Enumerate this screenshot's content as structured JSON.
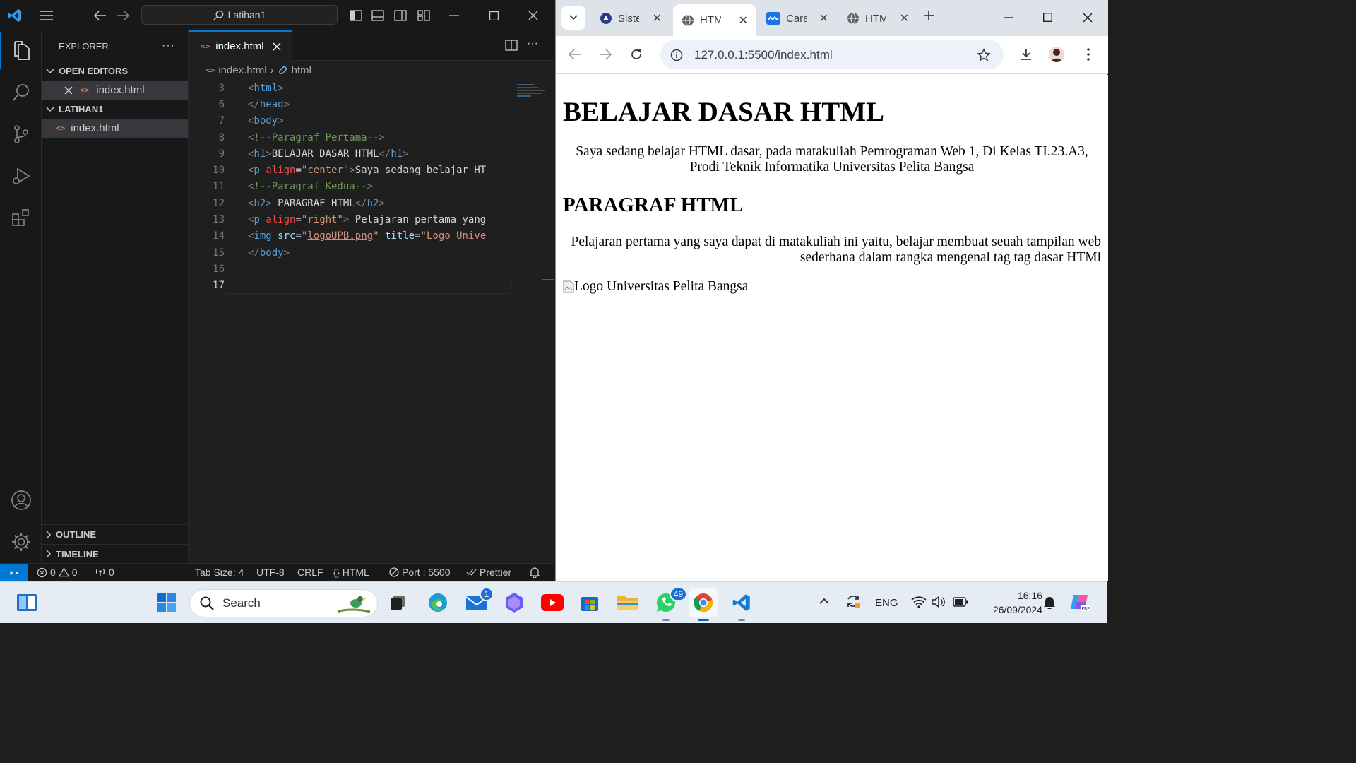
{
  "vscode": {
    "command_center": "Latihan1",
    "explorer": {
      "title": "EXPLORER",
      "open_editors_label": "OPEN EDITORS",
      "open_file": "index.html",
      "folder_label": "LATIHAN1",
      "folder_file": "index.html",
      "outline_label": "OUTLINE",
      "timeline_label": "TIMELINE"
    },
    "tab": {
      "label": "index.html"
    },
    "breadcrumb": {
      "file": "index.html",
      "symbol": "html"
    },
    "code_lines": [
      {
        "num": "3",
        "tokens": [
          {
            "c": "tg",
            "t": "<"
          },
          {
            "c": "tn",
            "t": "html"
          },
          {
            "c": "tg",
            "t": ">"
          }
        ]
      },
      {
        "num": "6",
        "tokens": [
          {
            "c": "tg",
            "t": "</"
          },
          {
            "c": "tn",
            "t": "head"
          },
          {
            "c": "tg",
            "t": ">"
          }
        ]
      },
      {
        "num": "7",
        "tokens": [
          {
            "c": "tg",
            "t": "<"
          },
          {
            "c": "tn",
            "t": "body"
          },
          {
            "c": "tg",
            "t": ">"
          }
        ]
      },
      {
        "num": "8",
        "tokens": [
          {
            "c": "cm",
            "t": "<!--Paragraf Pertama-->"
          }
        ]
      },
      {
        "num": "9",
        "tokens": [
          {
            "c": "tg",
            "t": "<"
          },
          {
            "c": "tn",
            "t": "h1"
          },
          {
            "c": "tg",
            "t": ">"
          },
          {
            "c": "tx",
            "t": "BELAJAR DASAR HTML"
          },
          {
            "c": "tg",
            "t": "</"
          },
          {
            "c": "tn",
            "t": "h1"
          },
          {
            "c": "tg",
            "t": ">"
          }
        ]
      },
      {
        "num": "10",
        "tokens": [
          {
            "c": "tg",
            "t": "<"
          },
          {
            "c": "tn",
            "t": "p"
          },
          {
            "c": "tx",
            "t": " "
          },
          {
            "c": "ar",
            "t": "align"
          },
          {
            "c": "tx",
            "t": "="
          },
          {
            "c": "st",
            "t": "\"center\""
          },
          {
            "c": "tg",
            "t": ">"
          },
          {
            "c": "tx",
            "t": "Saya sedang belajar HT"
          }
        ]
      },
      {
        "num": "11",
        "tokens": [
          {
            "c": "cm",
            "t": "<!--Paragraf Kedua-->"
          }
        ]
      },
      {
        "num": "12",
        "tokens": [
          {
            "c": "tg",
            "t": "<"
          },
          {
            "c": "tn",
            "t": "h2"
          },
          {
            "c": "tg",
            "t": ">"
          },
          {
            "c": "tx",
            "t": " PARAGRAF HTML"
          },
          {
            "c": "tg",
            "t": "</"
          },
          {
            "c": "tn",
            "t": "h2"
          },
          {
            "c": "tg",
            "t": ">"
          }
        ]
      },
      {
        "num": "13",
        "tokens": [
          {
            "c": "tg",
            "t": "<"
          },
          {
            "c": "tn",
            "t": "p"
          },
          {
            "c": "tx",
            "t": " "
          },
          {
            "c": "ar",
            "t": "align"
          },
          {
            "c": "tx",
            "t": "="
          },
          {
            "c": "st",
            "t": "\"right\""
          },
          {
            "c": "tg",
            "t": ">"
          },
          {
            "c": "tx",
            "t": " Pelajaran pertama yang"
          }
        ]
      },
      {
        "num": "14",
        "tokens": [
          {
            "c": "tg",
            "t": "<"
          },
          {
            "c": "tn",
            "t": "img"
          },
          {
            "c": "tx",
            "t": " "
          },
          {
            "c": "at",
            "t": "src"
          },
          {
            "c": "tx",
            "t": "="
          },
          {
            "c": "st",
            "t": "\""
          },
          {
            "c": "st ul",
            "t": "logoUPB.png"
          },
          {
            "c": "st",
            "t": "\""
          },
          {
            "c": "tx",
            "t": " "
          },
          {
            "c": "at",
            "t": "title"
          },
          {
            "c": "tx",
            "t": "="
          },
          {
            "c": "st",
            "t": "\"Logo Unive"
          }
        ]
      },
      {
        "num": "15",
        "tokens": [
          {
            "c": "tg",
            "t": "</"
          },
          {
            "c": "tn",
            "t": "body"
          },
          {
            "c": "tg",
            "t": ">"
          }
        ]
      },
      {
        "num": "16",
        "tokens": []
      },
      {
        "num": "17",
        "tokens": [],
        "current": true
      }
    ],
    "status": {
      "errors": "0",
      "warnings": "0",
      "ports": "0",
      "tab_size": "Tab Size: 4",
      "encoding": "UTF-8",
      "eol": "CRLF",
      "language": "HTML",
      "port": "Port : 5500",
      "formatter": "Prettier"
    }
  },
  "chrome": {
    "tabs": [
      {
        "title": "Siste",
        "active": false
      },
      {
        "title": "HTM",
        "active": true
      },
      {
        "title": "Cara",
        "active": false
      },
      {
        "title": "HTM",
        "active": false
      }
    ],
    "url": "127.0.0.1:5500/index.html",
    "page": {
      "h1": "BELAJAR DASAR HTML",
      "p1": "Saya sedang belajar HTML dasar, pada matakuliah Pemrograman Web 1, Di Kelas TI.23.A3, Prodi Teknik Informatika Universitas Pelita Bangsa",
      "h2": "PARAGRAF HTML",
      "p2": "Pelajaran pertama yang saya dapat di matakuliah ini yaitu, belajar membuat seuah tampilan web sederhana dalam rangka mengenal tag tag dasar HTMl",
      "img_alt": "Logo Universitas Pelita Bangsa"
    }
  },
  "taskbar": {
    "search_placeholder": "Search",
    "mail_badge": "1",
    "whatsapp_badge": "49",
    "language": "ENG",
    "time": "16:16",
    "date": "26/09/2024"
  },
  "colors": {
    "vscode_accent": "#0078d4",
    "code_tag_name": "#569cd6",
    "code_attr": "#9cdcfe",
    "code_string": "#ce9178",
    "code_comment": "#6a9955"
  }
}
